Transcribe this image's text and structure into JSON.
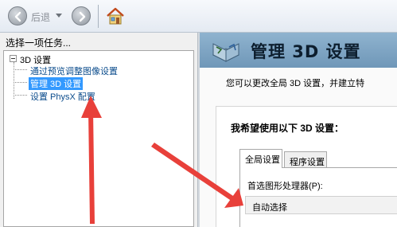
{
  "toolbar": {
    "back_label": "后退",
    "back_icon": "arrow-left-icon",
    "forward_icon": "arrow-right-icon",
    "home_icon": "home-icon"
  },
  "left_pane": {
    "task_prompt": "选择一项任务...",
    "tree": {
      "root_label": "3D 设置",
      "items": [
        {
          "label": "通过预览调整图像设置",
          "selected": false
        },
        {
          "label": "管理 3D 设置",
          "selected": true
        },
        {
          "label": "设置 PhysX 配置",
          "selected": false
        }
      ]
    }
  },
  "right_pane": {
    "banner_title": "管理 3D 设置",
    "banner_icon": "3d-settings-icon",
    "description": "您可以更改全局 3D 设置，并建立特",
    "section_title": "我希望使用以下 3D 设置：",
    "tabs": [
      {
        "label": "全局设置",
        "active": true
      },
      {
        "label": "程序设置",
        "active": false
      }
    ],
    "gpu_label": "首选图形处理器(P):",
    "gpu_value": "自动选择"
  },
  "colors": {
    "selection": "#3399ff",
    "link": "#0b4c8c",
    "banner": "#7fa5c4",
    "annotation_arrow": "#e8403a"
  }
}
